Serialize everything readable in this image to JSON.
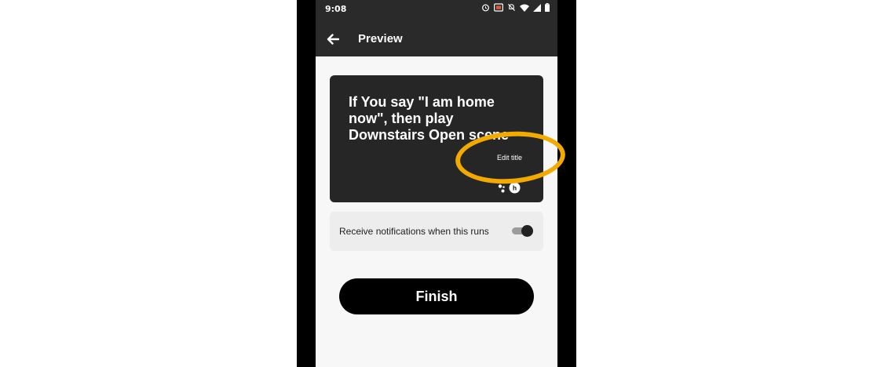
{
  "status_bar": {
    "time": "9:08",
    "icons": [
      "alarm-icon",
      "cast-icon",
      "mute-icon",
      "wifi-icon",
      "signal-icon",
      "battery-icon"
    ]
  },
  "app_bar": {
    "back_icon": "arrow-left-icon",
    "title": "Preview"
  },
  "card": {
    "title": "If You say \"I am home now\", then play Downstairs Open scene",
    "edit_title_label": "Edit title",
    "icons": [
      "google-assistant-icon",
      "hue-icon"
    ]
  },
  "notifications": {
    "label": "Receive notifications when this runs",
    "enabled": true
  },
  "finish_button": {
    "label": "Finish"
  },
  "colors": {
    "header_bg": "#2a2a2a",
    "card_bg": "#262626",
    "screen_bg": "#f7f7f7",
    "highlight": "#f2a900",
    "button_bg": "#000000"
  }
}
